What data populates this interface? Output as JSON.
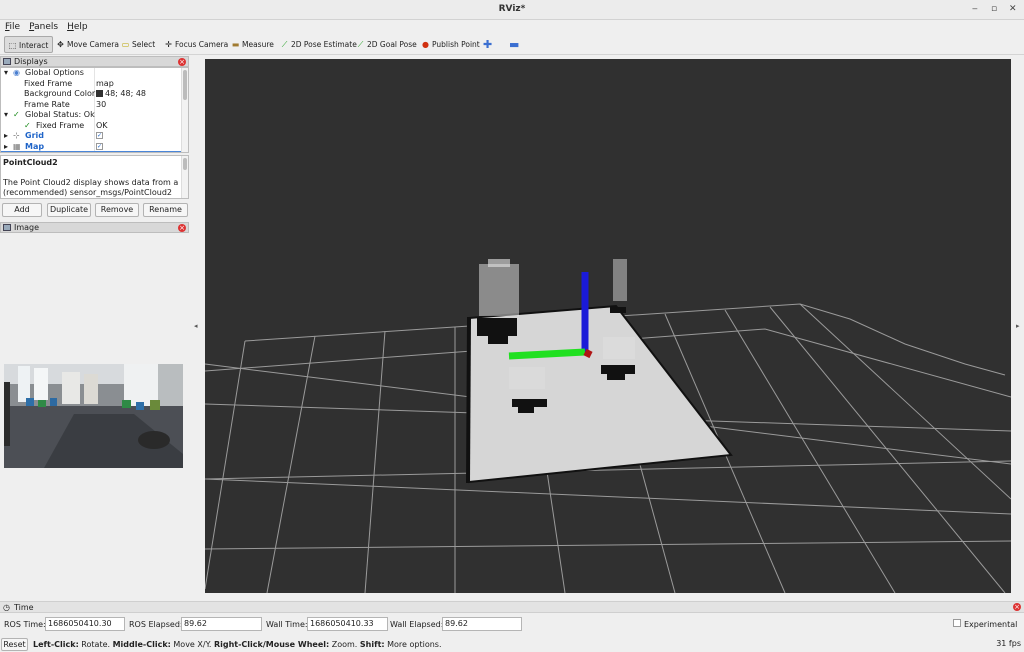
{
  "window": {
    "title": "RViz*",
    "controls": [
      "‒",
      "▫",
      "✕"
    ]
  },
  "menu": [
    "File",
    "Panels",
    "Help"
  ],
  "toolbar": {
    "interact": "Interact",
    "move_camera": "Move Camera",
    "select": "Select",
    "focus_camera": "Focus Camera",
    "measure": "Measure",
    "pose_estimate": "2D Pose Estimate",
    "goal_pose": "2D Goal Pose",
    "publish_point": "Publish Point"
  },
  "displays": {
    "title": "Displays",
    "rows": [
      {
        "arrow": "▾",
        "check": "",
        "key": "Global Options",
        "value": ""
      },
      {
        "arrow": "",
        "check": "",
        "key": "Fixed Frame",
        "value": "map"
      },
      {
        "arrow": "",
        "check": "",
        "key": "Background Color",
        "value": "48; 48; 48"
      },
      {
        "arrow": "",
        "check": "",
        "key": "Frame Rate",
        "value": "30"
      },
      {
        "arrow": "▾",
        "check": "✓",
        "key": "Global Status: Ok",
        "value": ""
      },
      {
        "arrow": "",
        "check": "✓",
        "key": "Fixed Frame",
        "value": "OK"
      },
      {
        "arrow": "▸",
        "check": "",
        "key": "Grid",
        "value": ""
      },
      {
        "arrow": "▸",
        "check": "",
        "key": "Map",
        "value": ""
      }
    ],
    "desc_title": "PointCloud2",
    "desc_text": "The Point Cloud2 display shows data from a (recommended) sensor_msgs/PointCloud2",
    "buttons": {
      "add": "Add",
      "duplicate": "Duplicate",
      "remove": "Remove",
      "rename": "Rename"
    }
  },
  "image_panel": {
    "title": "Image"
  },
  "viewport": {
    "background": "#303030"
  },
  "time": {
    "title": "Time",
    "ros_time_label": "ROS Time:",
    "ros_time": "1686050410.30",
    "ros_elapsed_label": "ROS Elapsed:",
    "ros_elapsed": "89.62",
    "wall_time_label": "Wall Time:",
    "wall_time": "1686050410.33",
    "wall_elapsed_label": "Wall Elapsed:",
    "wall_elapsed": "89.62",
    "experimental": "Experimental"
  },
  "status": {
    "reset": "Reset",
    "b1": "Left-Click:",
    "t1": " Rotate. ",
    "b2": "Middle-Click:",
    "t2": " Move X/Y. ",
    "b3": "Right-Click/Mouse Wheel:",
    "t3": " Zoom. ",
    "b4": "Shift:",
    "t4": " More options.",
    "fps": "31 fps"
  }
}
